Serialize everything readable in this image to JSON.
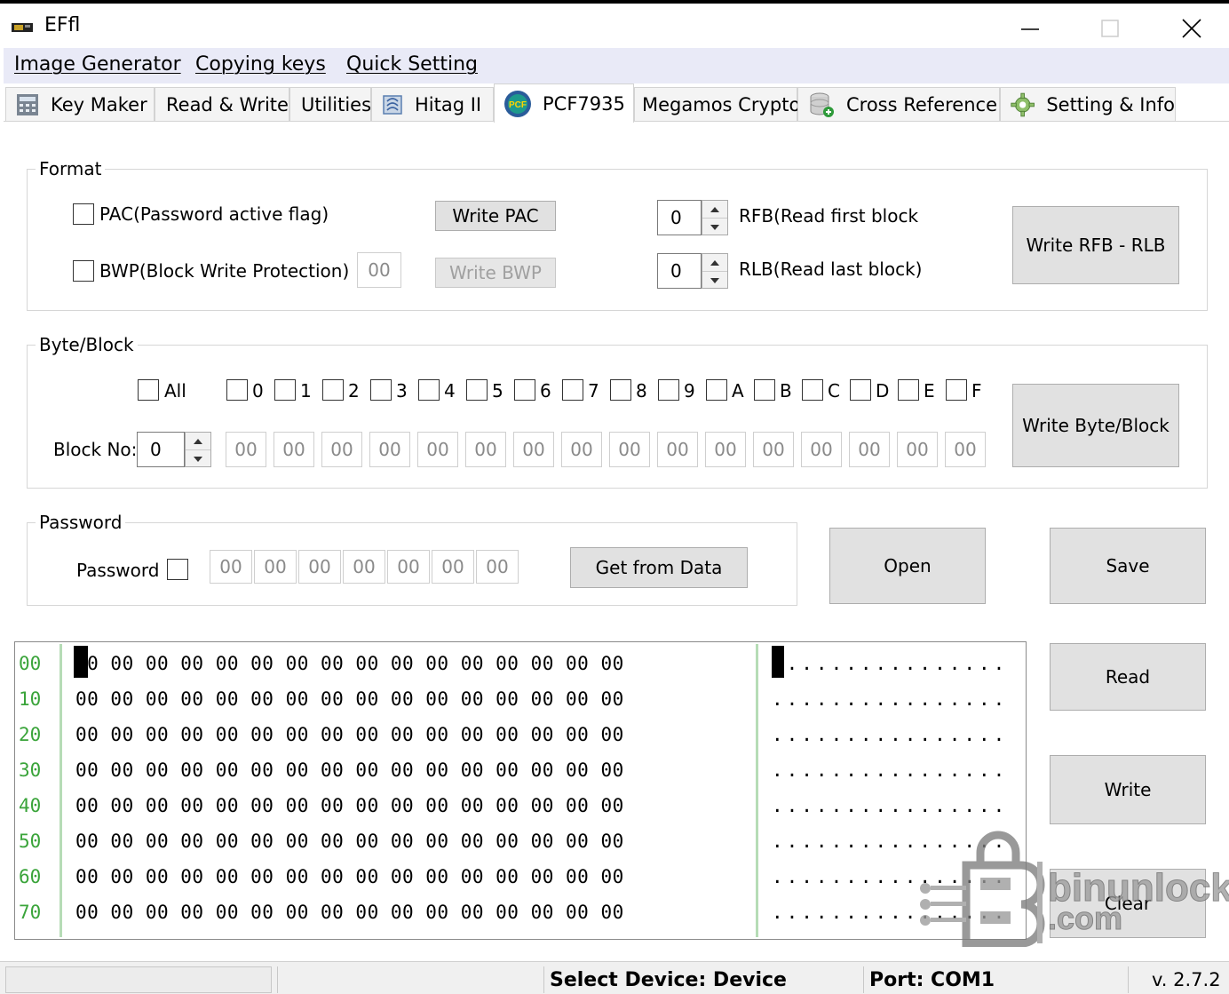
{
  "window": {
    "title": "EFfl",
    "minimize": "—",
    "maximize": "☐",
    "close": "✕"
  },
  "menu": [
    "Image Generator",
    "Copying keys",
    "Quick Setting"
  ],
  "tabs": [
    {
      "label": "Key Maker",
      "icon": "calculator-icon"
    },
    {
      "label": "Read & Write",
      "icon": ""
    },
    {
      "label": "Utilities",
      "icon": ""
    },
    {
      "label": "Hitag II",
      "icon": "chip-icon"
    },
    {
      "label": "PCF7935",
      "icon": "pcf-badge-icon",
      "active": true
    },
    {
      "label": "Megamos Crypto",
      "icon": ""
    },
    {
      "label": "Cross Reference",
      "icon": "database-icon"
    },
    {
      "label": "Setting & Info",
      "icon": "gear-icon"
    }
  ],
  "format": {
    "title": "Format",
    "pac_label": "PAC(Password active flag)",
    "bwp_label": "BWP(Block Write Protection)",
    "bwp_value": "00",
    "write_pac": "Write PAC",
    "write_bwp": "Write BWP",
    "rfb_value": "0",
    "rfb_label": "RFB(Read first block",
    "rlb_value": "0",
    "rlb_label": "RLB(Read last block)",
    "write_rfb_rlb": "Write RFB - RLB"
  },
  "byte_block": {
    "title": "Byte/Block",
    "all_label": "All",
    "bytes": [
      "0",
      "1",
      "2",
      "3",
      "4",
      "5",
      "6",
      "7",
      "8",
      "9",
      "A",
      "B",
      "C",
      "D",
      "E",
      "F"
    ],
    "block_no_label": "Block No:",
    "block_no_value": "0",
    "values": [
      "00",
      "00",
      "00",
      "00",
      "00",
      "00",
      "00",
      "00",
      "00",
      "00",
      "00",
      "00",
      "00",
      "00",
      "00",
      "00"
    ],
    "write_button": "Write Byte/Block"
  },
  "password": {
    "title": "Password",
    "label": "Password",
    "values": [
      "00",
      "00",
      "00",
      "00",
      "00",
      "00",
      "00"
    ],
    "get_from_data": "Get from Data"
  },
  "buttons": {
    "open": "Open",
    "save": "Save",
    "read": "Read",
    "write": "Write",
    "clear": "Clear"
  },
  "hex_view": {
    "rows": [
      {
        "addr": "00",
        "bytes": "00 00 00 00 00 00 00 00 00 00 00 00 00 00 00 00",
        "ascii": "................"
      },
      {
        "addr": "10",
        "bytes": "00 00 00 00 00 00 00 00 00 00 00 00 00 00 00 00",
        "ascii": "................"
      },
      {
        "addr": "20",
        "bytes": "00 00 00 00 00 00 00 00 00 00 00 00 00 00 00 00",
        "ascii": "................"
      },
      {
        "addr": "30",
        "bytes": "00 00 00 00 00 00 00 00 00 00 00 00 00 00 00 00",
        "ascii": "................"
      },
      {
        "addr": "40",
        "bytes": "00 00 00 00 00 00 00 00 00 00 00 00 00 00 00 00",
        "ascii": "................"
      },
      {
        "addr": "50",
        "bytes": "00 00 00 00 00 00 00 00 00 00 00 00 00 00 00 00",
        "ascii": "................"
      },
      {
        "addr": "60",
        "bytes": "00 00 00 00 00 00 00 00 00 00 00 00 00 00 00 00",
        "ascii": "................"
      },
      {
        "addr": "70",
        "bytes": "00 00 00 00 00 00 00 00 00 00 00 00 00 00 00 00",
        "ascii": "................"
      }
    ]
  },
  "status": {
    "select_device": "Select Device:  Device",
    "port": "Port:  COM1",
    "version": "v. 2.7.2"
  },
  "watermark": {
    "brand": "binunlock",
    "domain": ".com"
  },
  "colors": {
    "menubar": "#e9eaf7",
    "hex_addr": "#3aa43a",
    "cursor": "#ffd400"
  }
}
